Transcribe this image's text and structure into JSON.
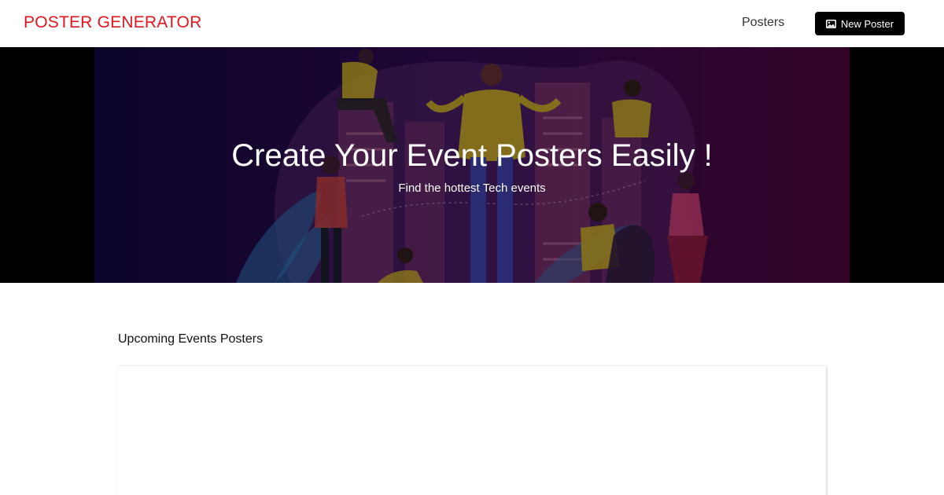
{
  "navbar": {
    "brand": "POSTER GENERATOR",
    "posters_link": "Posters",
    "new_poster_button": "New Poster",
    "new_poster_icon": "image-icon"
  },
  "hero": {
    "title": "Create Your Event Posters Easily !",
    "subtitle": "Find the hottest Tech events"
  },
  "main": {
    "section_heading": "Upcoming Events Posters"
  },
  "colors": {
    "brand": "#e3161d",
    "button_bg": "#000000",
    "hero_left": "#120738",
    "hero_right": "#470536"
  }
}
